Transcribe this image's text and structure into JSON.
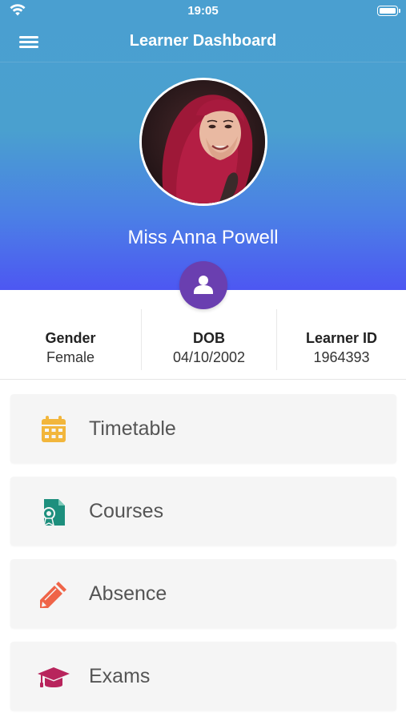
{
  "status_bar": {
    "time": "19:05"
  },
  "nav": {
    "title": "Learner Dashboard"
  },
  "learner": {
    "name": "Miss Anna Powell"
  },
  "details": [
    {
      "label": "Gender",
      "value": "Female"
    },
    {
      "label": "DOB",
      "value": "04/10/2002"
    },
    {
      "label": "Learner ID",
      "value": "1964393"
    }
  ],
  "menu": [
    {
      "label": "Timetable",
      "icon": "calendar-icon",
      "color": "#f2b63c"
    },
    {
      "label": "Courses",
      "icon": "course-certificate-icon",
      "color": "#1d8f7d"
    },
    {
      "label": "Absence",
      "icon": "pencil-icon",
      "color": "#ef6448"
    },
    {
      "label": "Exams",
      "icon": "graduation-cap-icon",
      "color": "#b8245c"
    }
  ],
  "colors": {
    "header_top": "#4a9fd0",
    "header_bottom": "#4d57f2",
    "badge": "#6a3fb0",
    "card_background": "#f5f5f5"
  }
}
